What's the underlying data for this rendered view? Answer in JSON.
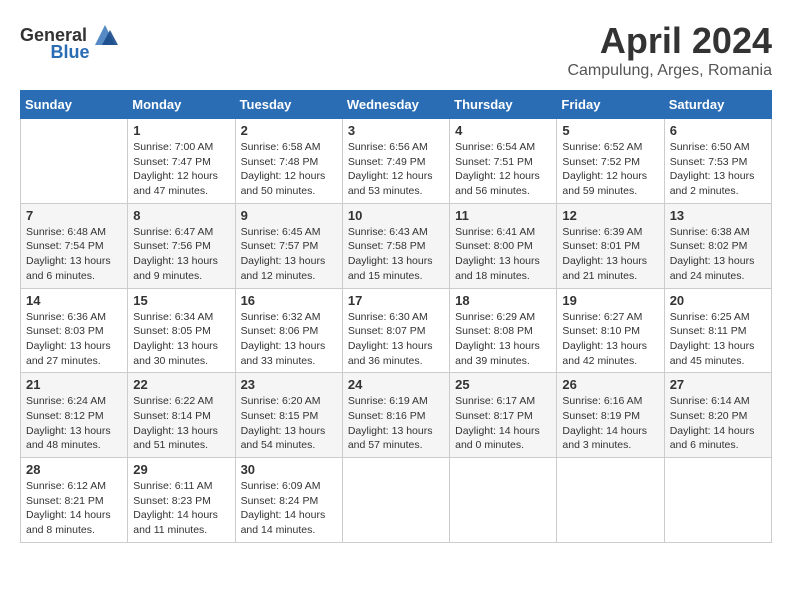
{
  "header": {
    "logo_general": "General",
    "logo_blue": "Blue",
    "month_year": "April 2024",
    "location": "Campulung, Arges, Romania"
  },
  "weekdays": [
    "Sunday",
    "Monday",
    "Tuesday",
    "Wednesday",
    "Thursday",
    "Friday",
    "Saturday"
  ],
  "weeks": [
    [
      {
        "day": "",
        "sunrise": "",
        "sunset": "",
        "daylight": ""
      },
      {
        "day": "1",
        "sunrise": "Sunrise: 7:00 AM",
        "sunset": "Sunset: 7:47 PM",
        "daylight": "Daylight: 12 hours and 47 minutes."
      },
      {
        "day": "2",
        "sunrise": "Sunrise: 6:58 AM",
        "sunset": "Sunset: 7:48 PM",
        "daylight": "Daylight: 12 hours and 50 minutes."
      },
      {
        "day": "3",
        "sunrise": "Sunrise: 6:56 AM",
        "sunset": "Sunset: 7:49 PM",
        "daylight": "Daylight: 12 hours and 53 minutes."
      },
      {
        "day": "4",
        "sunrise": "Sunrise: 6:54 AM",
        "sunset": "Sunset: 7:51 PM",
        "daylight": "Daylight: 12 hours and 56 minutes."
      },
      {
        "day": "5",
        "sunrise": "Sunrise: 6:52 AM",
        "sunset": "Sunset: 7:52 PM",
        "daylight": "Daylight: 12 hours and 59 minutes."
      },
      {
        "day": "6",
        "sunrise": "Sunrise: 6:50 AM",
        "sunset": "Sunset: 7:53 PM",
        "daylight": "Daylight: 13 hours and 2 minutes."
      }
    ],
    [
      {
        "day": "7",
        "sunrise": "Sunrise: 6:48 AM",
        "sunset": "Sunset: 7:54 PM",
        "daylight": "Daylight: 13 hours and 6 minutes."
      },
      {
        "day": "8",
        "sunrise": "Sunrise: 6:47 AM",
        "sunset": "Sunset: 7:56 PM",
        "daylight": "Daylight: 13 hours and 9 minutes."
      },
      {
        "day": "9",
        "sunrise": "Sunrise: 6:45 AM",
        "sunset": "Sunset: 7:57 PM",
        "daylight": "Daylight: 13 hours and 12 minutes."
      },
      {
        "day": "10",
        "sunrise": "Sunrise: 6:43 AM",
        "sunset": "Sunset: 7:58 PM",
        "daylight": "Daylight: 13 hours and 15 minutes."
      },
      {
        "day": "11",
        "sunrise": "Sunrise: 6:41 AM",
        "sunset": "Sunset: 8:00 PM",
        "daylight": "Daylight: 13 hours and 18 minutes."
      },
      {
        "day": "12",
        "sunrise": "Sunrise: 6:39 AM",
        "sunset": "Sunset: 8:01 PM",
        "daylight": "Daylight: 13 hours and 21 minutes."
      },
      {
        "day": "13",
        "sunrise": "Sunrise: 6:38 AM",
        "sunset": "Sunset: 8:02 PM",
        "daylight": "Daylight: 13 hours and 24 minutes."
      }
    ],
    [
      {
        "day": "14",
        "sunrise": "Sunrise: 6:36 AM",
        "sunset": "Sunset: 8:03 PM",
        "daylight": "Daylight: 13 hours and 27 minutes."
      },
      {
        "day": "15",
        "sunrise": "Sunrise: 6:34 AM",
        "sunset": "Sunset: 8:05 PM",
        "daylight": "Daylight: 13 hours and 30 minutes."
      },
      {
        "day": "16",
        "sunrise": "Sunrise: 6:32 AM",
        "sunset": "Sunset: 8:06 PM",
        "daylight": "Daylight: 13 hours and 33 minutes."
      },
      {
        "day": "17",
        "sunrise": "Sunrise: 6:30 AM",
        "sunset": "Sunset: 8:07 PM",
        "daylight": "Daylight: 13 hours and 36 minutes."
      },
      {
        "day": "18",
        "sunrise": "Sunrise: 6:29 AM",
        "sunset": "Sunset: 8:08 PM",
        "daylight": "Daylight: 13 hours and 39 minutes."
      },
      {
        "day": "19",
        "sunrise": "Sunrise: 6:27 AM",
        "sunset": "Sunset: 8:10 PM",
        "daylight": "Daylight: 13 hours and 42 minutes."
      },
      {
        "day": "20",
        "sunrise": "Sunrise: 6:25 AM",
        "sunset": "Sunset: 8:11 PM",
        "daylight": "Daylight: 13 hours and 45 minutes."
      }
    ],
    [
      {
        "day": "21",
        "sunrise": "Sunrise: 6:24 AM",
        "sunset": "Sunset: 8:12 PM",
        "daylight": "Daylight: 13 hours and 48 minutes."
      },
      {
        "day": "22",
        "sunrise": "Sunrise: 6:22 AM",
        "sunset": "Sunset: 8:14 PM",
        "daylight": "Daylight: 13 hours and 51 minutes."
      },
      {
        "day": "23",
        "sunrise": "Sunrise: 6:20 AM",
        "sunset": "Sunset: 8:15 PM",
        "daylight": "Daylight: 13 hours and 54 minutes."
      },
      {
        "day": "24",
        "sunrise": "Sunrise: 6:19 AM",
        "sunset": "Sunset: 8:16 PM",
        "daylight": "Daylight: 13 hours and 57 minutes."
      },
      {
        "day": "25",
        "sunrise": "Sunrise: 6:17 AM",
        "sunset": "Sunset: 8:17 PM",
        "daylight": "Daylight: 14 hours and 0 minutes."
      },
      {
        "day": "26",
        "sunrise": "Sunrise: 6:16 AM",
        "sunset": "Sunset: 8:19 PM",
        "daylight": "Daylight: 14 hours and 3 minutes."
      },
      {
        "day": "27",
        "sunrise": "Sunrise: 6:14 AM",
        "sunset": "Sunset: 8:20 PM",
        "daylight": "Daylight: 14 hours and 6 minutes."
      }
    ],
    [
      {
        "day": "28",
        "sunrise": "Sunrise: 6:12 AM",
        "sunset": "Sunset: 8:21 PM",
        "daylight": "Daylight: 14 hours and 8 minutes."
      },
      {
        "day": "29",
        "sunrise": "Sunrise: 6:11 AM",
        "sunset": "Sunset: 8:23 PM",
        "daylight": "Daylight: 14 hours and 11 minutes."
      },
      {
        "day": "30",
        "sunrise": "Sunrise: 6:09 AM",
        "sunset": "Sunset: 8:24 PM",
        "daylight": "Daylight: 14 hours and 14 minutes."
      },
      {
        "day": "",
        "sunrise": "",
        "sunset": "",
        "daylight": ""
      },
      {
        "day": "",
        "sunrise": "",
        "sunset": "",
        "daylight": ""
      },
      {
        "day": "",
        "sunrise": "",
        "sunset": "",
        "daylight": ""
      },
      {
        "day": "",
        "sunrise": "",
        "sunset": "",
        "daylight": ""
      }
    ]
  ]
}
